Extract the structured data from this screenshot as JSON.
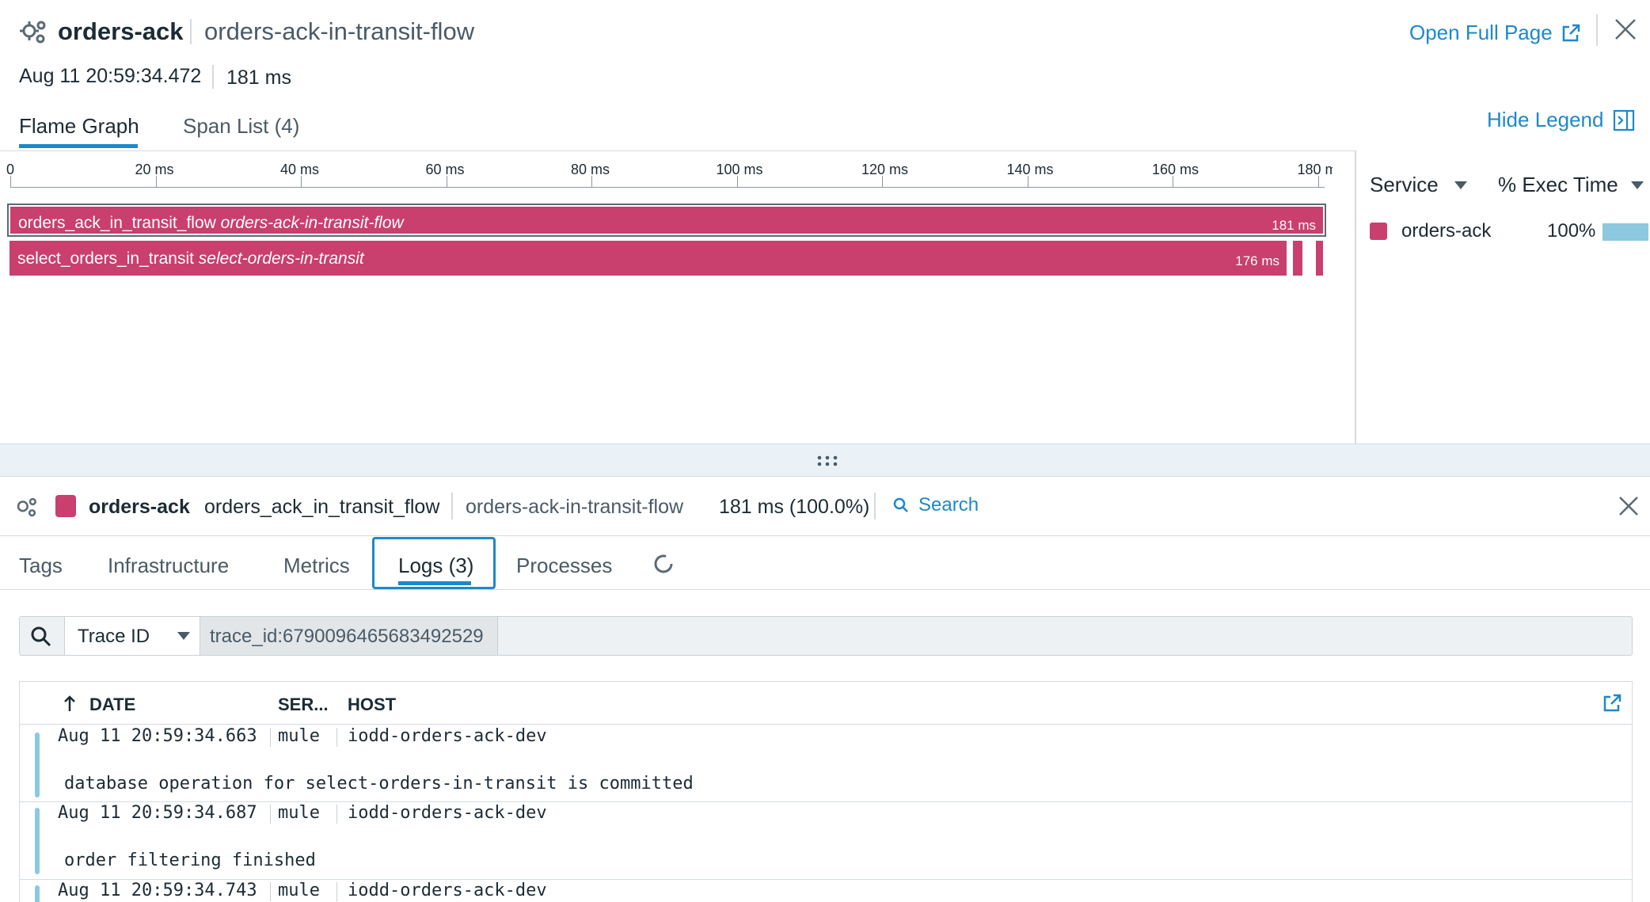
{
  "header": {
    "service": "orders-ack",
    "resource": "orders-ack-in-transit-flow",
    "timestamp": "Aug 11 20:59:34.472",
    "duration": "181 ms",
    "open_full_page": "Open Full Page"
  },
  "tabs": {
    "flame_graph": "Flame Graph",
    "span_list": "Span List (4)",
    "hide_legend": "Hide Legend"
  },
  "timeline": {
    "ticks": [
      "0",
      "20 ms",
      "40 ms",
      "60 ms",
      "80 ms",
      "100 ms",
      "120 ms",
      "140 ms",
      "160 ms",
      "180 m"
    ]
  },
  "spans": [
    {
      "name": "orders_ack_in_transit_flow",
      "resource": "orders-ack-in-transit-flow",
      "duration": "181 ms"
    },
    {
      "name": "select_orders_in_transit",
      "resource": "select-orders-in-transit",
      "duration": "176 ms"
    }
  ],
  "legend": {
    "col_service": "Service",
    "col_exec": "% Exec Time",
    "rows": [
      {
        "service": "orders-ack",
        "percent": "100%",
        "color": "#c93f6e",
        "fraction": 1.0
      }
    ]
  },
  "span_panel": {
    "service": "orders-ack",
    "operation": "orders_ack_in_transit_flow",
    "resource": "orders-ack-in-transit-flow",
    "duration": "181 ms (100.0%)",
    "search": "Search",
    "tabs": [
      "Tags",
      "Infrastructure",
      "Metrics",
      "Logs (3)",
      "Processes"
    ],
    "active_tab": "Logs (3)"
  },
  "logs": {
    "facet": "Trace ID",
    "query": "trace_id:6790096465683492529",
    "columns": {
      "date": "DATE",
      "service": "SER...",
      "host": "HOST"
    },
    "rows": [
      {
        "date": "Aug 11 20:59:34.663",
        "service": "mule",
        "host": "iodd-orders-ack-dev",
        "message": "database operation for select-orders-in-transit is committed"
      },
      {
        "date": "Aug 11 20:59:34.687",
        "service": "mule",
        "host": "iodd-orders-ack-dev",
        "message": "order filtering finished"
      },
      {
        "date": "Aug 11 20:59:34.743",
        "service": "mule",
        "host": "iodd-orders-ack-dev",
        "message": ""
      }
    ]
  },
  "colors": {
    "accent": "#1e88c9",
    "span": "#c93f6e",
    "exec_bar": "#8cc8e0"
  }
}
